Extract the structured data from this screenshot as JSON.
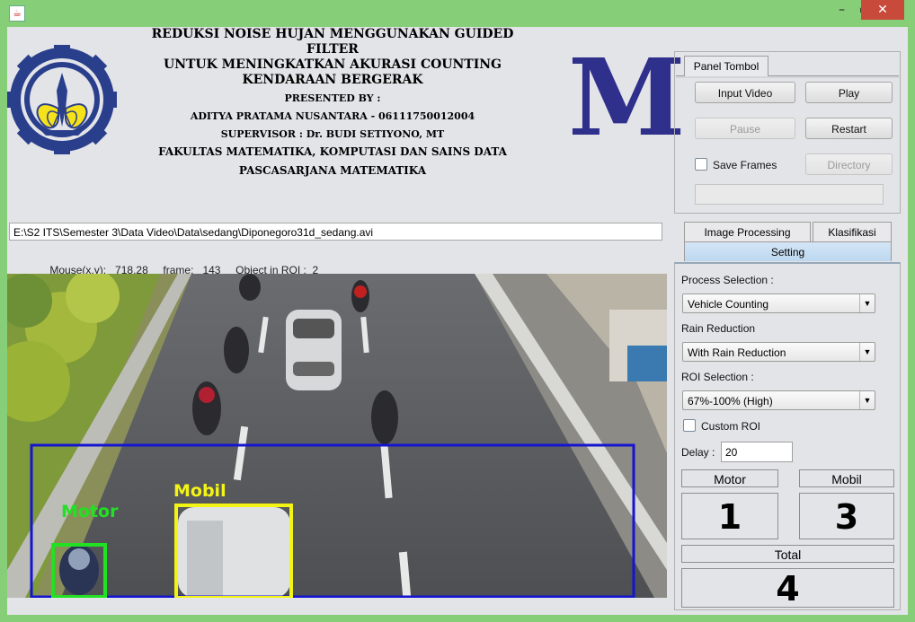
{
  "window": {
    "title": "",
    "min": "–",
    "max": "▭",
    "close": "✕",
    "icon": "java-icon"
  },
  "header": {
    "title1": "REDUKSI NOISE HUJAN MENGGUNAKAN GUIDED FILTER",
    "title2": "UNTUK MENINGKATKAN AKURASI COUNTING",
    "title3": "KENDARAAN BERGERAK",
    "presented": "PRESENTED BY :",
    "author": "ADITYA PRATAMA NUSANTARA - 06111750012004",
    "supervisor": "SUPERVISOR : Dr. BUDI SETIYONO, MT",
    "faculty": "FAKULTAS MATEMATIKA, KOMPUTASI DAN SAINS DATA",
    "program": "PASCASARJANA MATEMATIKA",
    "logo_letter": "M"
  },
  "file_path": "E:\\S2 ITS\\Semester 3\\Data Video\\Data\\sedang\\Diponegoro31d_sedang.avi",
  "status": {
    "mouse_label": "Mouse(x,y):",
    "mouse_value": "718,28",
    "frame_label": "frame:",
    "frame_value": "143",
    "roi_label": "Object in ROI :",
    "roi_value": "2"
  },
  "video": {
    "label_motor": "Motor",
    "label_mobil": "Mobil",
    "colors": {
      "roi": "#1515d0",
      "motor": "#22e022",
      "mobil": "#f4f414"
    }
  },
  "panel": {
    "tab": "Panel Tombol",
    "input_video": "Input Video",
    "play": "Play",
    "pause": "Pause",
    "restart": "Restart",
    "save_frames": "Save Frames",
    "directory": "Directory"
  },
  "tabs": {
    "image_processing": "Image Processing",
    "klasifikasi": "Klasifikasi",
    "setting": "Setting"
  },
  "settings": {
    "process_label": "Process Selection :",
    "process_value": "Vehicle Counting",
    "rain_label": "Rain Reduction",
    "rain_value": "With Rain Reduction",
    "roi_label": "ROI Selection :",
    "roi_value": "67%-100% (High)",
    "custom_roi": "Custom ROI",
    "delay_label": "Delay :",
    "delay_value": "20"
  },
  "counts": {
    "motor_label": "Motor",
    "motor_value": "1",
    "mobil_label": "Mobil",
    "mobil_value": "3",
    "total_label": "Total",
    "total_value": "4"
  }
}
